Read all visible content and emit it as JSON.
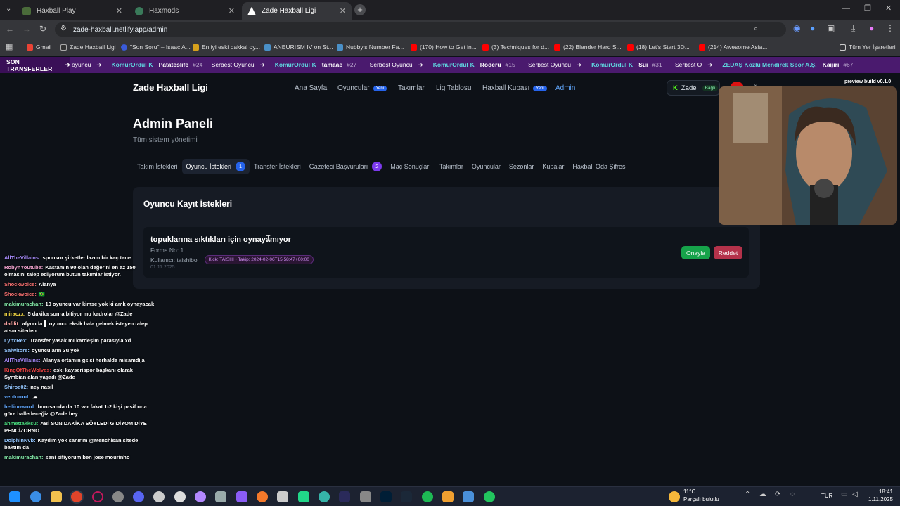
{
  "browser": {
    "tabs": [
      {
        "title": "Haxball Play",
        "color": "#4a6b3a"
      },
      {
        "title": "Haxmods",
        "color": "#3a7a5a"
      },
      {
        "title": "Zade Haxball Ligi",
        "color": "#222222"
      }
    ],
    "url": "zade-haxball.netlify.app/admin",
    "bookmarks": [
      {
        "label": "Gmail",
        "color": "#ea4335"
      },
      {
        "label": "Zade Haxball Ligi",
        "color": "#333333"
      },
      {
        "label": "\"Son Soru\" – Isaac A...",
        "color": "#3a5bd9"
      },
      {
        "label": "En iyi eski bakkal oy...",
        "color": "#d6a01c"
      },
      {
        "label": "ANEURISM IV on St...",
        "color": "#4a90c8"
      },
      {
        "label": "Nubby's Number Fa...",
        "color": "#4a90c8"
      },
      {
        "label": "(170) How to Get in...",
        "color": "#ff0000"
      },
      {
        "label": "(3) Techniques for d...",
        "color": "#ff0000"
      },
      {
        "label": "(22) Blender Hard S...",
        "color": "#ff0000"
      },
      {
        "label": "(18) Let's Start 3D...",
        "color": "#ff0000"
      },
      {
        "label": "(214) Awesome Asia...",
        "color": "#ff0000"
      }
    ],
    "all_bookmarks": "Tüm Yer İşaretleri"
  },
  "ticker": {
    "label": "SON TRANSFERLER",
    "lead": "oyuncu",
    "items": [
      {
        "team": "KömürOrduFK",
        "player": "Patateslife",
        "num": "#24",
        "from": "Serbest Oyuncu"
      },
      {
        "team": "KömürOrduFK",
        "player": "tamaae",
        "num": "#27",
        "from": "Serbest Oyuncu"
      },
      {
        "team": "KömürOrduFK",
        "player": "Roderu",
        "num": "#15",
        "from": "Serbest Oyuncu"
      },
      {
        "team": "KömürOrduFK",
        "player": "Sui",
        "num": "#31",
        "from": "Serbest Oyuncu"
      },
      {
        "team": "ZEDAŞ Kozlu Mendirek Spor A.Ş.",
        "player": "Kaijiri",
        "num": "#67",
        "from": "Serbest O"
      }
    ]
  },
  "site": {
    "logo": "Zade Haxball Ligi",
    "nav": [
      {
        "label": "Ana Sayfa",
        "badge": ""
      },
      {
        "label": "Oyuncular",
        "badge": "Yeni"
      },
      {
        "label": "Takımlar",
        "badge": ""
      },
      {
        "label": "Lig Tablosu",
        "badge": ""
      },
      {
        "label": "Haxball Kupası",
        "badge": "Yeni"
      },
      {
        "label": "Admin",
        "badge": ""
      }
    ],
    "user": {
      "name": "Zade",
      "status": "Bağlı"
    },
    "preview": "preview build v0.1.0"
  },
  "admin": {
    "title": "Admin Paneli",
    "subtitle": "Tüm sistem yönetimi",
    "tabs": [
      {
        "label": "Takım İstekleri",
        "count": ""
      },
      {
        "label": "Oyuncu İstekleri",
        "count": "1"
      },
      {
        "label": "Transfer İstekleri",
        "count": ""
      },
      {
        "label": "Gazeteci Başvuruları",
        "count": "2"
      },
      {
        "label": "Maç Sonuçları",
        "count": ""
      },
      {
        "label": "Takımlar",
        "count": ""
      },
      {
        "label": "Oyuncular",
        "count": ""
      },
      {
        "label": "Sezonlar",
        "count": ""
      },
      {
        "label": "Kupalar",
        "count": ""
      },
      {
        "label": "Haxball Oda Şifresi",
        "count": ""
      }
    ],
    "section_title": "Oyuncu Kayıt İstekleri",
    "request": {
      "title": "topuklarına sıktıkları için oynayamıyor",
      "forma": "Forma No: 1",
      "user": "Kullanıcı: taishiboi",
      "kick": "Kick: TAISHI • Takip: 2024-02-06T15:58:47+00:00",
      "date": "01.11.2025",
      "approve": "Onayla",
      "reject": "Reddet"
    }
  },
  "chat": [
    {
      "user": "AllTheVillains:",
      "color": "#a78bfa",
      "text": "sponsor şirketler lazım bir kaç tane"
    },
    {
      "user": "RobynYoutube:",
      "color": "#f9a8d4",
      "text": "Kastamın 90 olan değerini en az 150 olmasını talep ediyorum bütün takımlar istiyor."
    },
    {
      "user": "Shockwoice:",
      "color": "#f87171",
      "text": "Alanya"
    },
    {
      "user": "Shockwoice:",
      "color": "#f87171",
      "text": "🇧🇷"
    },
    {
      "user": "makimurachan:",
      "color": "#86efac",
      "text": "10 oyuncu var kimse yok ki amk oynayacak"
    },
    {
      "user": "miraczx:",
      "color": "#fde047",
      "text": "5 dakika sonra bitiyor mu kadrolar @Zade"
    },
    {
      "user": "dafilit:",
      "color": "#fca5a5",
      "text": "afyonda ▌ oyuncu eksik hala gelmek isteyen talep atsın siteden"
    },
    {
      "user": "LynxRex:",
      "color": "#93c5fd",
      "text": "Transfer yasak mı kardeşim parasıyla xd"
    },
    {
      "user": "Salwitore:",
      "color": "#93c5fd",
      "text": "oyuncuların 3ü yok"
    },
    {
      "user": "AllTheVillains:",
      "color": "#a78bfa",
      "text": "Alanya ortamın gs'si herhalde misamdija"
    },
    {
      "user": "KingOfTheWolves:",
      "color": "#ef4444",
      "text": "eski kayserispor başkanı olarak Symbian alan yaşadı @Zade"
    },
    {
      "user": "Shiroe02:",
      "color": "#93c5fd",
      "text": "ney nasıl"
    },
    {
      "user": "ventorout:",
      "color": "#60a5fa",
      "text": "☁"
    },
    {
      "user": "hellionword:",
      "color": "#60a5fa",
      "text": "borusanda da 10 var fakat 1-2 kişi pasif ona göre halledeceğiz @Zade bey"
    },
    {
      "user": "ahmettakksu:",
      "color": "#4ade80",
      "text": "ABİ SON DAKİKA SÖYLEDİ GİDİYOM DİYE PENCİZORNO"
    },
    {
      "user": "DolphinNvb:",
      "color": "#93c5fd",
      "text": "Kaydım yok sanırım @Menchisan sitede baktım da"
    },
    {
      "user": "makimurachan:",
      "color": "#86efac",
      "text": "seni sifiyorum ben jose mourinho"
    }
  ],
  "taskbar": {
    "weather_temp": "11°C",
    "weather_desc": "Parçalı bulutlu",
    "lang": "TUR",
    "time": "18:41",
    "date": "1.11.2025"
  }
}
